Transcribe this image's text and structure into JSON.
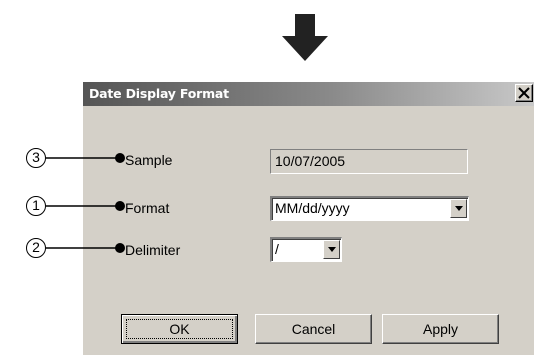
{
  "dialog": {
    "title": "Date Display Format",
    "close_icon": "close-icon"
  },
  "rows": {
    "sample": {
      "label": "Sample",
      "value": "10/07/2005"
    },
    "format": {
      "label": "Format",
      "value": "MM/dd/yyyy"
    },
    "delimiter": {
      "label": "Delimiter",
      "value": "/"
    }
  },
  "buttons": {
    "ok": "OK",
    "cancel": "Cancel",
    "apply": "Apply"
  },
  "callouts": {
    "sample_marker": "③",
    "format_marker": "①",
    "delimiter_marker": "②"
  },
  "decor": {
    "arrow_icon": "down-arrow-icon"
  }
}
